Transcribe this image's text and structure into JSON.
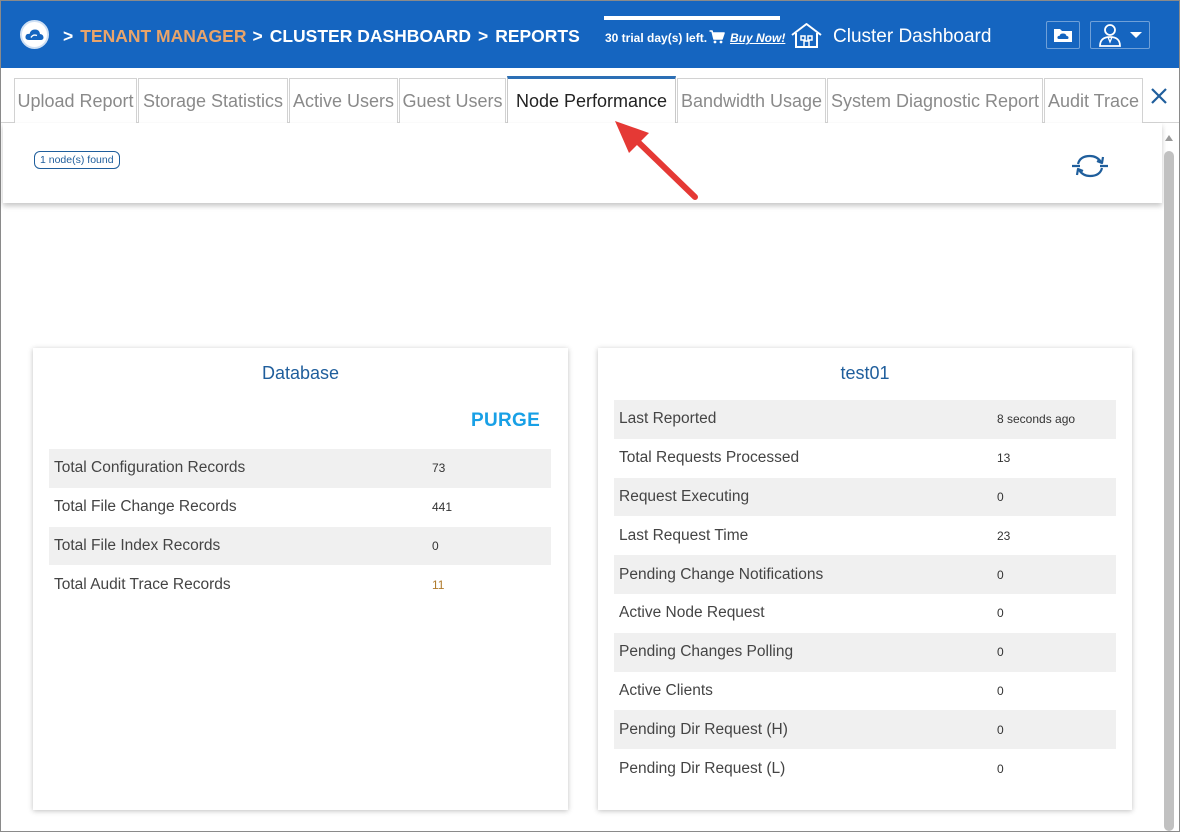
{
  "header": {
    "breadcrumb": {
      "sep1": ">",
      "tenant": "TENANT MANAGER",
      "sep2": ">",
      "dashboard": "CLUSTER DASHBOARD",
      "sep3": ">",
      "reports": "REPORTS"
    },
    "trial_text": "30 trial day(s) left.",
    "buy_now": "Buy Now!",
    "title": "Cluster Dashboard",
    "icons": [
      "cloud-logo-icon",
      "cart-icon",
      "house-icon",
      "folder-icon",
      "user-icon",
      "caret-down-icon"
    ]
  },
  "tabs": [
    {
      "label": "Upload Report",
      "active": false
    },
    {
      "label": "Storage Statistics",
      "active": false
    },
    {
      "label": "Active Users",
      "active": false
    },
    {
      "label": "Guest Users",
      "active": false
    },
    {
      "label": "Node Performance",
      "active": true
    },
    {
      "label": "Bandwidth Usage",
      "active": false
    },
    {
      "label": "System Diagnostic Report",
      "active": false
    },
    {
      "label": "Audit Trace",
      "active": false
    }
  ],
  "info": {
    "nodes_found": "1 node(s) found"
  },
  "database": {
    "title": "Database",
    "purge_label": "PURGE",
    "rows": [
      {
        "label": "Total Configuration Records",
        "value": "73"
      },
      {
        "label": "Total File Change Records",
        "value": "441"
      },
      {
        "label": "Total File Index Records",
        "value": "0"
      },
      {
        "label": "Total Audit Trace Records",
        "value": "11"
      }
    ]
  },
  "node": {
    "title": "test01",
    "rows": [
      {
        "label": "Last Reported",
        "value": "8 seconds ago"
      },
      {
        "label": "Total Requests Processed",
        "value": "13"
      },
      {
        "label": "Request Executing",
        "value": "0"
      },
      {
        "label": "Last Request Time",
        "value": "23"
      },
      {
        "label": "Pending Change Notifications",
        "value": "0"
      },
      {
        "label": "Active Node Request",
        "value": "0"
      },
      {
        "label": "Pending Changes Polling",
        "value": "0"
      },
      {
        "label": "Active Clients",
        "value": "0"
      },
      {
        "label": "Pending Dir Request (H)",
        "value": "0"
      },
      {
        "label": "Pending Dir Request (L)",
        "value": "0"
      }
    ]
  },
  "colors": {
    "header_bg": "#1565c0",
    "tenant_accent": "#e9a46a",
    "link_blue": "#1f5e9c",
    "purge": "#18a0e6",
    "annotation_arrow": "#e53935"
  }
}
